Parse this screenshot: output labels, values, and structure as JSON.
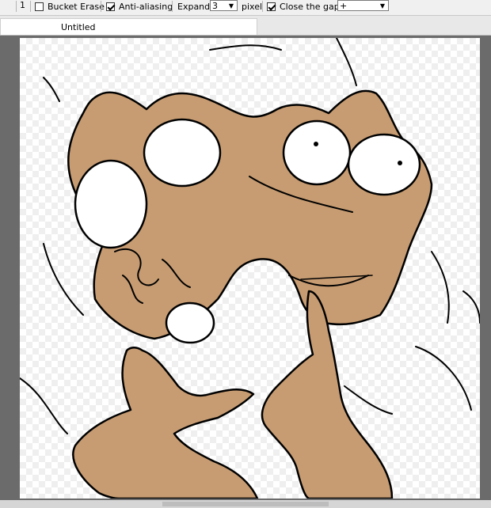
{
  "toolbar": {
    "tolerance_value": "1",
    "bucket_erase": {
      "label": "Bucket Erase",
      "checked": false
    },
    "anti_aliasing": {
      "label": "Anti-aliasing",
      "checked": true
    },
    "expand": {
      "label": "Expand",
      "value": "3",
      "unit": "pixel"
    },
    "close_gap": {
      "label": "Close the gap",
      "checked": true,
      "value": "+"
    }
  },
  "tabs": [
    {
      "label": "Untitled"
    }
  ],
  "colors": {
    "fill": "#c79c72",
    "line": "#000000"
  }
}
